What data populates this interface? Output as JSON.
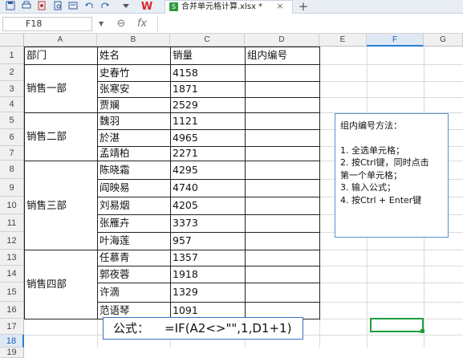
{
  "toolbar": {
    "icons": [
      "save-icon",
      "print-icon",
      "export-icon",
      "print-preview-icon",
      "undo-icon",
      "redo-icon",
      "dropdown-icon"
    ],
    "logo": "W",
    "doc_tab": "合并单元格计算.xlsx *",
    "close_glyph": "×",
    "add_glyph": "+"
  },
  "formula_bar": {
    "name_box": "F18",
    "zoom_glyph": "⊖",
    "fx_label": "fx",
    "value": ""
  },
  "columns": [
    "A",
    "B",
    "C",
    "D",
    "E",
    "F",
    "G"
  ],
  "selected_column": "F",
  "rows": [
    "1",
    "2",
    "3",
    "4",
    "5",
    "6",
    "7",
    "8",
    "9",
    "10",
    "11",
    "12",
    "13",
    "14",
    "15",
    "16",
    "17",
    "18",
    "19"
  ],
  "selected_row": "18",
  "table": {
    "headers": [
      "部门",
      "姓名",
      "销量",
      "组内编号"
    ],
    "groups": [
      {
        "dept": "销售一部",
        "rows": [
          [
            "史春竹",
            "4158"
          ],
          [
            "张寒安",
            "1871"
          ],
          [
            "贾斓",
            "2529"
          ]
        ]
      },
      {
        "dept": "销售二部",
        "rows": [
          [
            "魏羽",
            "1121"
          ],
          [
            "於湛",
            "4965"
          ],
          [
            "孟靖柏",
            "2271"
          ]
        ]
      },
      {
        "dept": "销售三部",
        "rows": [
          [
            "陈晓霜",
            "4295"
          ],
          [
            "阎映易",
            "4740"
          ],
          [
            "刘易烟",
            "4205"
          ],
          [
            "张雁卉",
            "3373"
          ],
          [
            "叶海莲",
            "957"
          ]
        ]
      },
      {
        "dept": "销售四部",
        "rows": [
          [
            "任慕青",
            "1357"
          ],
          [
            "郭夜蓉",
            "1918"
          ],
          [
            "许滴",
            "1329"
          ],
          [
            "范语琴",
            "1091"
          ]
        ]
      }
    ]
  },
  "note": {
    "title": "组内编号方法：",
    "lines": [
      "1. 全选单元格；",
      "2. 按Ctrl键，同时点击",
      "第一个单元格；",
      "3. 输入公式；",
      "4. 按Ctrl + Enter键"
    ]
  },
  "formula_display": "公式：    =IF(A2<>\"\",1,D1+1)",
  "active_cell": "F18",
  "colors": {
    "accent": "#2e7cd4",
    "active_cell": "#1f9e3e",
    "note_border": "#5b8fd0"
  }
}
